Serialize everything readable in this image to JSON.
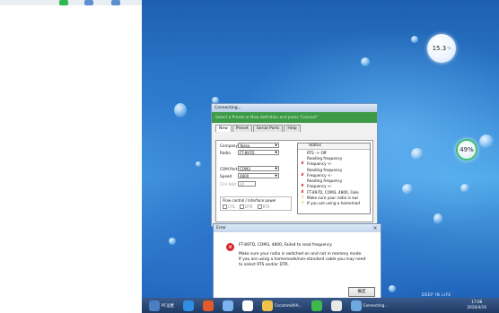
{
  "desktop": {
    "wallpaper_caption": "DEEP IN LIFE",
    "colors": {
      "accent_green": "#2eb84e",
      "error_red": "#c0141a"
    }
  },
  "gadgets": {
    "temperature": {
      "value": "15.3",
      "unit": "°C"
    },
    "percent": {
      "value": "49%"
    }
  },
  "connecting_window": {
    "title": "Connecting...",
    "banner": "Select a Preset or New definition and press 'Connect'",
    "tabs": [
      "New",
      "Preset",
      "Serial Ports",
      "Help"
    ],
    "fields": {
      "company_label": "Company",
      "company_value": "Yaesu",
      "radio_label": "Radio",
      "radio_value": "FT-897D",
      "com_label": "COM Port",
      "com_value": "COM3",
      "speed_label": "Speed",
      "speed_value": "4800",
      "civ_label": "CI-V Add",
      "civ_value": "20"
    },
    "flow_control": {
      "label": "Flow control / Interface power",
      "options": [
        "CTS",
        "DTR",
        "RTS"
      ]
    },
    "status": {
      "header": "Status",
      "lines": [
        {
          "icon": "",
          "text": "RTS -> Off"
        },
        {
          "icon": "",
          "text": "Reading frequency"
        },
        {
          "icon": "x",
          "text": "Frequency <-"
        },
        {
          "icon": "",
          "text": "Reading frequency"
        },
        {
          "icon": "x",
          "text": "Frequency <-"
        },
        {
          "icon": "",
          "text": "Reading frequency"
        },
        {
          "icon": "x",
          "text": "Frequency <-"
        },
        {
          "icon": "x",
          "text": "FT-897D, COM3, 4800, Faile"
        },
        {
          "icon": "warn",
          "text": "Make sure your radio is swi"
        },
        {
          "icon": "warn",
          "text": "If you are using a homemad"
        }
      ]
    }
  },
  "error_dialog": {
    "title": "Error",
    "line1": "FT-897D, COM3, 4800, Failed to read frequency",
    "line2": "Make sure your radio is switched on and not in memory mode.",
    "line3": "If you are using a homemade/non-standard cable you may need",
    "line4": "to select RTS and/or DTR.",
    "ok_label": "确定"
  },
  "taskbar": {
    "items": [
      {
        "label": "PC设置",
        "icon": "settings-icon",
        "color": "#4a7fc1"
      },
      {
        "label": "",
        "icon": "browser-icon",
        "color": "#2f8fe0"
      },
      {
        "label": "",
        "icon": "media-icon",
        "color": "#e35a2a"
      },
      {
        "label": "",
        "icon": "app-icon",
        "color": "#7ab3ef"
      },
      {
        "label": "",
        "icon": "cloud-icon",
        "color": "#ffffff"
      },
      {
        "label": "Cccamm4AA...",
        "icon": "folder-icon",
        "color": "#f1c24a"
      },
      {
        "label": "",
        "icon": "green-app-icon",
        "color": "#3fb84e"
      },
      {
        "label": "",
        "icon": "chat-icon",
        "color": "#e8e8e8"
      },
      {
        "label": "Connecting...",
        "icon": "radio-icon",
        "color": "#6fa8dc"
      }
    ],
    "clock_time": "17:08",
    "clock_date": "2020/4/16"
  }
}
